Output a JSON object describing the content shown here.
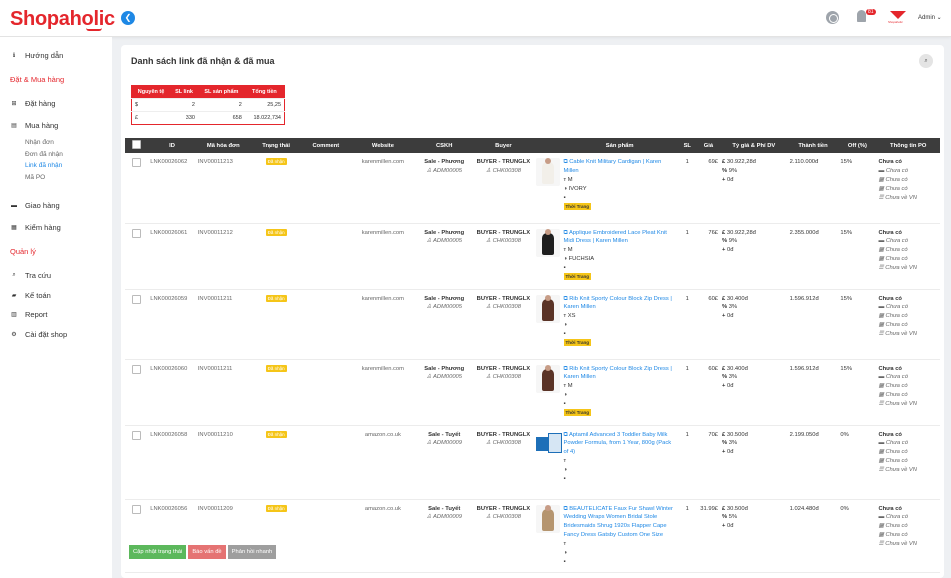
{
  "header": {
    "logo": "Shopaholic",
    "notif_count": "81",
    "user": "Admin",
    "avatar_text": "Shopaholic"
  },
  "sidebar": {
    "items": [
      {
        "icon": "info-icon",
        "glyph": "ℹ",
        "label": "Hướng dẫn"
      },
      {
        "section": "Đặt & Mua hàng"
      },
      {
        "icon": "cart-icon",
        "glyph": "⊞",
        "label": "Đặt hàng"
      },
      {
        "icon": "basket-icon",
        "glyph": "▤",
        "label": "Mua hàng"
      }
    ],
    "sub": [
      "Nhận đơn",
      "Đơn đã nhận",
      "Link đã nhận",
      "Mã PO"
    ],
    "items2": [
      {
        "icon": "truck-icon",
        "glyph": "▬",
        "label": "Giao hàng"
      },
      {
        "icon": "warehouse-icon",
        "glyph": "▦",
        "label": "Kiểm hàng"
      }
    ],
    "section2": "Quản lý",
    "items3": [
      {
        "icon": "search-icon",
        "glyph": "⌕",
        "label": "Tra cứu"
      },
      {
        "icon": "accounting-icon",
        "glyph": "▰",
        "label": "Kế toán"
      },
      {
        "icon": "report-icon",
        "glyph": "▥",
        "label": "Report"
      },
      {
        "icon": "settings-icon",
        "glyph": "⚙",
        "label": "Cài đặt shop"
      }
    ]
  },
  "page": {
    "title": "Danh sách link đã nhận & đã mua"
  },
  "summary": {
    "headers": [
      "Nguyên tệ",
      "SL link",
      "SL sản phẩm",
      "Tổng tiền"
    ],
    "rows": [
      [
        "$",
        "2",
        "2",
        "25,25"
      ],
      [
        "£",
        "330",
        "658",
        "18.022,734"
      ]
    ]
  },
  "table": {
    "headers": [
      "",
      "ID",
      "Mã hóa đơn",
      "Trạng thái",
      "Comment",
      "Website",
      "CSKH",
      "Buyer",
      "",
      "Sản phẩm",
      "SL",
      "Giá",
      "Tỷ giá & Phí DV",
      "Thành tiền",
      "Off (%)",
      "Thông tin PO"
    ],
    "status": "Đã nhận",
    "po": {
      "title": "Chưa có",
      "lines": [
        "Chưa có",
        "Chưa có",
        "Chưa có",
        "Chưa về VN"
      ]
    },
    "product_tag": "Thời Trang",
    "rows": [
      {
        "id": "LNK00026062",
        "inv": "INV00011213",
        "web": "karenmillen.com",
        "cskh": "Sale - Phương",
        "cskh_code": "ADM00005",
        "buyer": "BUYER - TRUNGLX",
        "buyer_code": "CHK00308",
        "prod": "Cable Knit Military Cardigan | Karen Millen",
        "size": "M",
        "color": "IVORY",
        "tag": true,
        "qty": "1",
        "price": "69£",
        "rate": "30.922,28đ",
        "fee": "9%",
        "plus": "0đ",
        "total": "2.110.000đ",
        "off": "15%",
        "thumb": "#f2efe9"
      },
      {
        "id": "LNK00026061",
        "inv": "INV00011212",
        "web": "karenmillen.com",
        "cskh": "Sale - Phương",
        "cskh_code": "ADM00005",
        "buyer": "BUYER - TRUNGLX",
        "buyer_code": "CHK00308",
        "prod": "Applique Embroidered Lace Pleat Knit Midi Dress | Karen Millen",
        "size": "M",
        "color": "FUCHSIA",
        "tag": true,
        "qty": "1",
        "price": "76£",
        "rate": "30.922,28đ",
        "fee": "9%",
        "plus": "0đ",
        "total": "2.355.000đ",
        "off": "15%",
        "thumb": "#1e1e1e"
      },
      {
        "id": "LNK00026059",
        "inv": "INV00011211",
        "web": "karenmillen.com",
        "cskh": "Sale - Phương",
        "cskh_code": "ADM00005",
        "buyer": "BUYER - TRUNGLX",
        "buyer_code": "CHK00308",
        "prod": "Rib Knit Sporty Colour Block Zip Dress | Karen Millen",
        "size": "XS",
        "color": "",
        "tag": true,
        "qty": "1",
        "price": "60£",
        "rate": "30.400đ",
        "fee": "3%",
        "plus": "0đ",
        "total": "1.596.912đ",
        "off": "15%",
        "thumb": "#5a3326"
      },
      {
        "id": "LNK00026060",
        "inv": "INV00011211",
        "web": "karenmillen.com",
        "cskh": "Sale - Phương",
        "cskh_code": "ADM00005",
        "buyer": "BUYER - TRUNGLX",
        "buyer_code": "CHK00308",
        "prod": "Rib Knit Sporty Colour Block Zip Dress | Karen Millen",
        "size": "M",
        "color": "",
        "tag": true,
        "qty": "1",
        "price": "60£",
        "rate": "30.400đ",
        "fee": "3%",
        "plus": "0đ",
        "total": "1.596.912đ",
        "off": "15%",
        "thumb": "#5a3326"
      },
      {
        "id": "LNK00026058",
        "inv": "INV00011210",
        "web": "amazon.co.uk",
        "cskh": "Sale - Tuyết",
        "cskh_code": "ADM00009",
        "buyer": "BUYER - TRUNGLX",
        "buyer_code": "CHK00308",
        "prod": "Aptamil Advanced 3 Toddler Baby Milk Powder Formula, from 1 Year, 800g (Pack of 4)",
        "size": "",
        "color": "",
        "tag": false,
        "qty": "1",
        "price": "70£",
        "rate": "30.500đ",
        "fee": "3%",
        "plus": "0đ",
        "total": "2.199.050đ",
        "off": "0%",
        "thumb": "box"
      },
      {
        "id": "LNK00026056",
        "inv": "INV00011209",
        "web": "amazon.co.uk",
        "cskh": "Sale - Tuyết",
        "cskh_code": "ADM00009",
        "buyer": "BUYER - TRUNGLX",
        "buyer_code": "CHK00308",
        "prod": "BEAUTELICATE Faux Fur Shawl Winter Wedding Wraps Women Bridal Stole Bridesmaids Shrug 1920s Flapper Cape Fancy Dress Gatsby Custom One Size",
        "size": "",
        "color": "",
        "tag": false,
        "qty": "1",
        "price": "31.99£",
        "rate": "30.500đ",
        "fee": "5%",
        "plus": "0đ",
        "total": "1.024.480đ",
        "off": "0%",
        "thumb": "#b5956f"
      }
    ]
  },
  "actions": [
    {
      "label": "Cập nhật trạng thái",
      "color": "#5cb85c"
    },
    {
      "label": "Báo vấn đề",
      "color": "#e57373"
    },
    {
      "label": "Phản hồi nhanh",
      "color": "#9e9e9e"
    }
  ]
}
